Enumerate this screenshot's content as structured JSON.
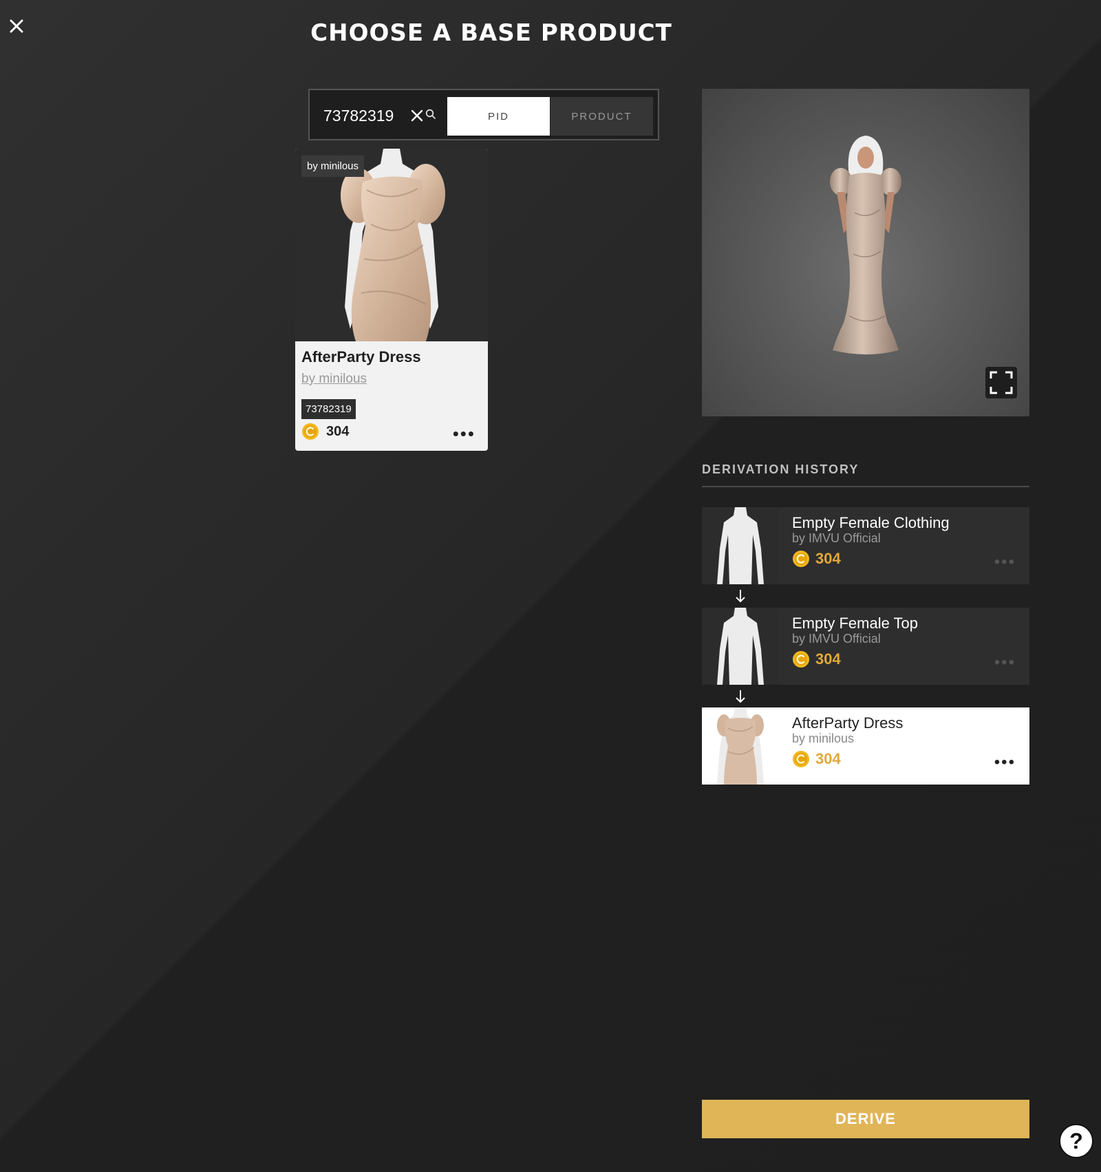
{
  "header": {
    "title": "CHOOSE A BASE PRODUCT",
    "close_icon": "close-icon"
  },
  "search": {
    "value": "73782319",
    "clear_icon": "close-icon",
    "search_icon": "search-icon",
    "tabs": [
      {
        "label": "PID",
        "active": true
      },
      {
        "label": "PRODUCT",
        "active": false
      }
    ]
  },
  "results": [
    {
      "creator_badge": "by minilous",
      "name": "AfterParty Dress",
      "creator": "by minilous",
      "pid": "73782319",
      "price": "304",
      "more_icon": "more-dots-icon"
    }
  ],
  "preview": {
    "fullscreen_icon": "fullscreen-icon"
  },
  "history": {
    "title": "DERIVATION HISTORY",
    "items": [
      {
        "name": "Empty Female Clothing",
        "creator": "by IMVU Official",
        "price": "304",
        "selected": false
      },
      {
        "name": "Empty Female Top",
        "creator": "by IMVU Official",
        "price": "304",
        "selected": false
      },
      {
        "name": "AfterParty Dress",
        "creator": "by minilous",
        "price": "304",
        "selected": true
      }
    ],
    "arrow_icon": "arrow-down-icon"
  },
  "actions": {
    "derive_label": "DERIVE",
    "help_label": "?"
  },
  "colors": {
    "background": "#1f1f1f",
    "accent": "#e0b558",
    "price": "#e0a93a",
    "coin": "#f2b81c"
  }
}
